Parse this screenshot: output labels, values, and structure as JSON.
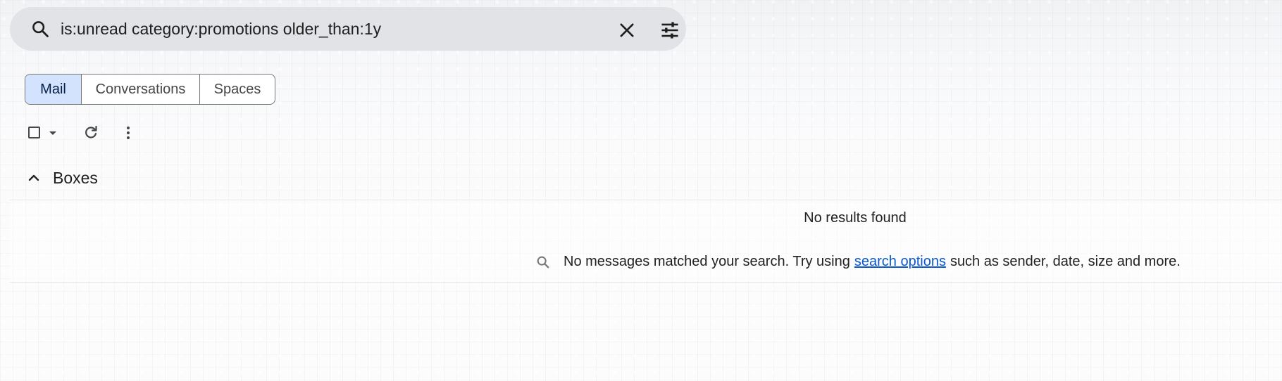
{
  "search": {
    "query": "is:unread category:promotions older_than:1y",
    "icons": {
      "search": "search-icon",
      "clear": "close-icon",
      "options": "tune-icon"
    }
  },
  "tabs": [
    {
      "label": "Mail",
      "active": true
    },
    {
      "label": "Conversations",
      "active": false
    },
    {
      "label": "Spaces",
      "active": false
    }
  ],
  "toolbar": {
    "icons": [
      "select-checkbox",
      "dropdown-caret-icon",
      "refresh-icon",
      "more-vert-icon"
    ]
  },
  "section": {
    "title": "Boxes",
    "icon": "chevron-up-icon"
  },
  "results": {
    "heading": "No results found",
    "message_before": "No messages matched your search. Try using",
    "link_text": "search options",
    "message_after": "such as sender, date, size and more.",
    "icon": "search-icon"
  },
  "colors": {
    "tab_active_bg": "#d3e3fd",
    "link": "#0b57d0",
    "search_bg": "#e1e3e6"
  }
}
